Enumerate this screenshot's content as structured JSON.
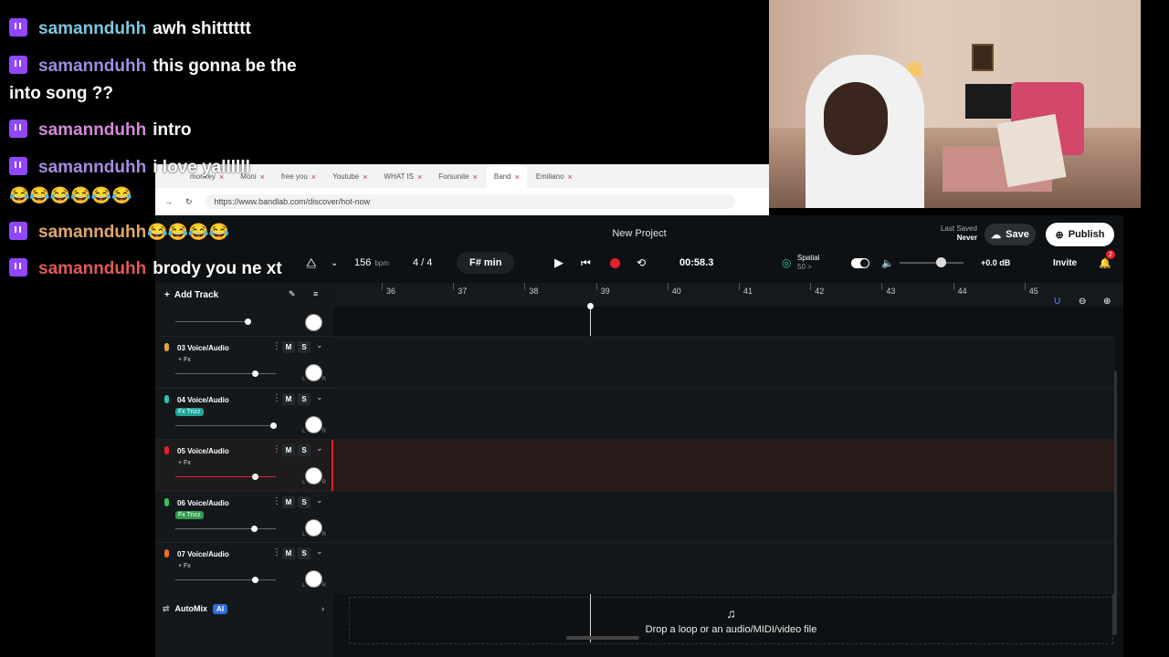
{
  "chat": {
    "messages": [
      {
        "user": "samannduhh",
        "color": "#7fc6e0",
        "text": "awh shitttttt",
        "emotes": ""
      },
      {
        "user": "samannduhh",
        "color": "#9c8ee0",
        "text": "this gonna be the into song ??",
        "emotes": ""
      },
      {
        "user": "samannduhh",
        "color": "#d38ad8",
        "text": "intro",
        "emotes": ""
      },
      {
        "user": "samannduhh",
        "color": "#a88ae0",
        "text": "i love yallllll",
        "emotes": "😂😂😂😂😂😂"
      },
      {
        "user": "samannduhh",
        "color": "#e0a86a",
        "text": "",
        "emotes": "😂😂😂😂"
      },
      {
        "user": "samannduhh",
        "color": "#e05a5a",
        "text": "brody you ne xt",
        "emotes": ""
      }
    ]
  },
  "browser": {
    "tabs": [
      "monkey",
      "Moni",
      "free you",
      "Youtube",
      "WHAT IS",
      "Forsunite",
      "Band",
      "Emiliano"
    ],
    "url": "https://www.bandlab.com/discover/hot-now"
  },
  "bandlab": {
    "project_title": "New Project",
    "last_saved_label": "Last Saved",
    "last_saved_value": "Never",
    "save": "Save",
    "publish": "Publish",
    "bpm": "156",
    "bpm_unit": "bpm",
    "time_sig": "4 / 4",
    "key": "F# min",
    "time": "00:58.3",
    "spatial": "Spatial",
    "spatial_sub": "50 >",
    "volume": "+0.0 dB",
    "invite": "Invite",
    "notif_count": "2",
    "add_track": "Add Track",
    "ruler": [
      "36",
      "37",
      "38",
      "39",
      "40",
      "41",
      "42",
      "43",
      "44",
      "45"
    ],
    "tracks": [
      {
        "name": "03 Voice/Audio",
        "fx": "+ Fx",
        "fx_style": "plain",
        "mic": "#e8a23b",
        "level": 0.8
      },
      {
        "name": "04 Voice/Audio",
        "fx": "Fx Trizz",
        "fx_style": "teal",
        "mic": "#2fc0b0",
        "level": 0.98
      },
      {
        "name": "05 Voice/Audio",
        "fx": "+ Fx",
        "fx_style": "plain",
        "mic": "#e5202b",
        "level": 0.8
      },
      {
        "name": "06 Voice/Audio",
        "fx": "Fx Trizz",
        "fx_style": "green",
        "mic": "#3bbf5a",
        "level": 0.79
      },
      {
        "name": "07 Voice/Audio",
        "fx": "+ Fx",
        "fx_style": "plain",
        "mic": "#f26b1d",
        "level": 0.8
      }
    ],
    "mute": "M",
    "solo": "S",
    "automix": "AutoMix",
    "ai": "AI",
    "drop_text": "Drop a loop or an audio/MIDI/video file"
  }
}
